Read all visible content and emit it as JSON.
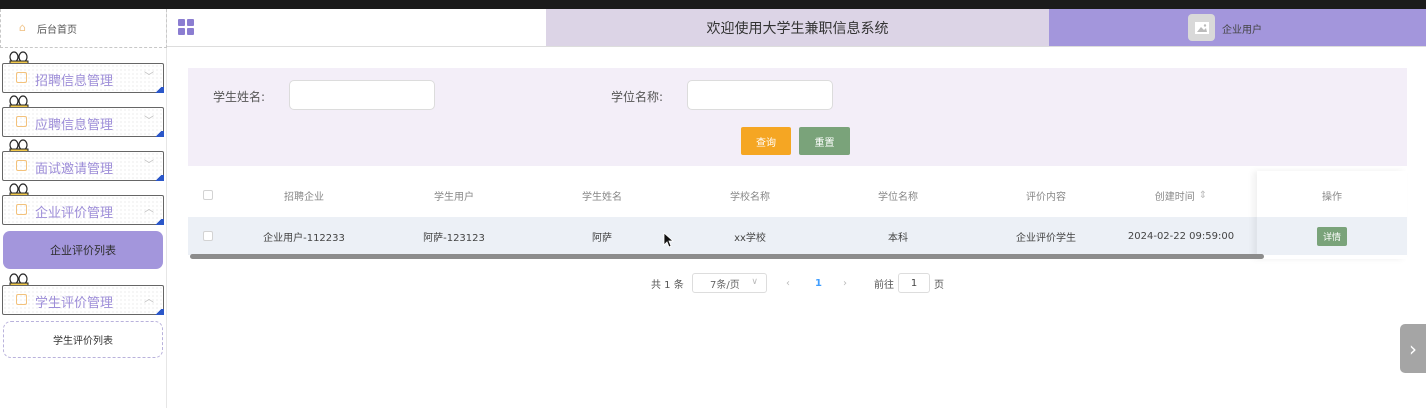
{
  "sidebar": {
    "home_label": "后台首页",
    "menus": [
      {
        "label": "招聘信息管理"
      },
      {
        "label": "应聘信息管理"
      },
      {
        "label": "面试邀请管理"
      },
      {
        "label": "企业评价管理"
      },
      {
        "label": "学生评价管理"
      }
    ],
    "active_sub": "企业评价列表",
    "sub_item": "学生评价列表"
  },
  "header": {
    "title": "欢迎使用大学生兼职信息系统",
    "user": "企业用户"
  },
  "search": {
    "student_name_label": "学生姓名:",
    "student_name_value": "",
    "degree_label": "学位名称:",
    "degree_value": "",
    "query_button": "查询",
    "reset_button": "重置"
  },
  "table": {
    "columns": [
      "招聘企业",
      "学生用户",
      "学生姓名",
      "学校名称",
      "学位名称",
      "评价内容",
      "创建时间",
      "操作"
    ],
    "sort_icon": "⇕",
    "rows": [
      {
        "company": "企业用户-112233",
        "student_user": "阿萨-123123",
        "student_name": "阿萨",
        "school": "xx学校",
        "degree": "本科",
        "content": "企业评价学生",
        "created": "2024-02-22 09:59:00",
        "action": "详情"
      }
    ]
  },
  "pagination": {
    "total": "共 1 条",
    "page_size": "7条/页",
    "current_page": "1",
    "goto_label": "前往",
    "goto_value": "1",
    "page_suffix": "页"
  },
  "colors": {
    "accent": "#a396dc",
    "query_button": "#f5a623",
    "reset_button": "#7aa37a",
    "title_bar": "#dcd4e6"
  }
}
